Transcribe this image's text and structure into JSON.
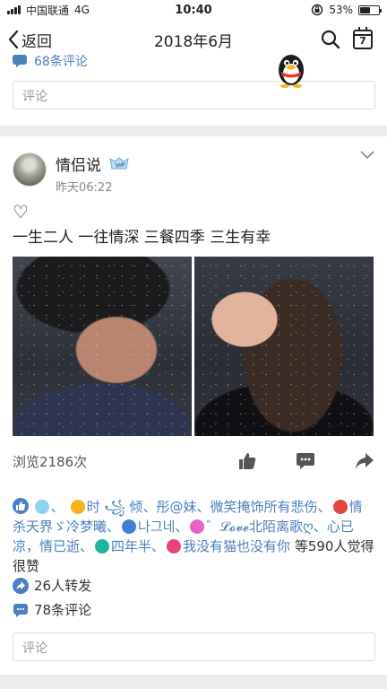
{
  "status_bar": {
    "carrier": "中国联通",
    "network": "4G",
    "time": "10:40",
    "battery": "53%",
    "battery_level": 0.53
  },
  "nav": {
    "back_label": "返回",
    "title": "2018年6月",
    "calendar_day": "7"
  },
  "previous_post": {
    "comment_count_partial": "68条评论",
    "comment_placeholder": "评论"
  },
  "post": {
    "author": "情侣说",
    "time": "昨天06:22",
    "heart": "♡",
    "text": "一生二人 一往情深 三餐四季 三生有幸",
    "views": "浏览2186次",
    "likers": [
      {
        "name": "时 ꧁ 倾、",
        "badge_color": "#f5b21a"
      },
      {
        "name": "彤@妹、微笑掩饰所有悲伤、",
        "badge_color": ""
      },
      {
        "name": "情杀天界ゞ冷梦曦、",
        "badge_color": "#e5433f"
      },
      {
        "name": "나그네、",
        "badge_color": "#3f7fd6"
      },
      {
        "name": "゛𝓛𝓸𝓿𝓮北陌离歌ღ、心已凉，情已逝、",
        "badge_color": "#ea62c8"
      },
      {
        "name": "四年半、",
        "badge_color": "#20b59e"
      },
      {
        "name": "我没有猫也没有你",
        "badge_color": "#e8437d"
      }
    ],
    "likes_suffix": "等590人觉得很赞",
    "shares": "26人转发",
    "comments": "78条评论",
    "comment_placeholder": "评论"
  },
  "colors": {
    "accent": "#4d7fbf",
    "background": "#ececec"
  }
}
